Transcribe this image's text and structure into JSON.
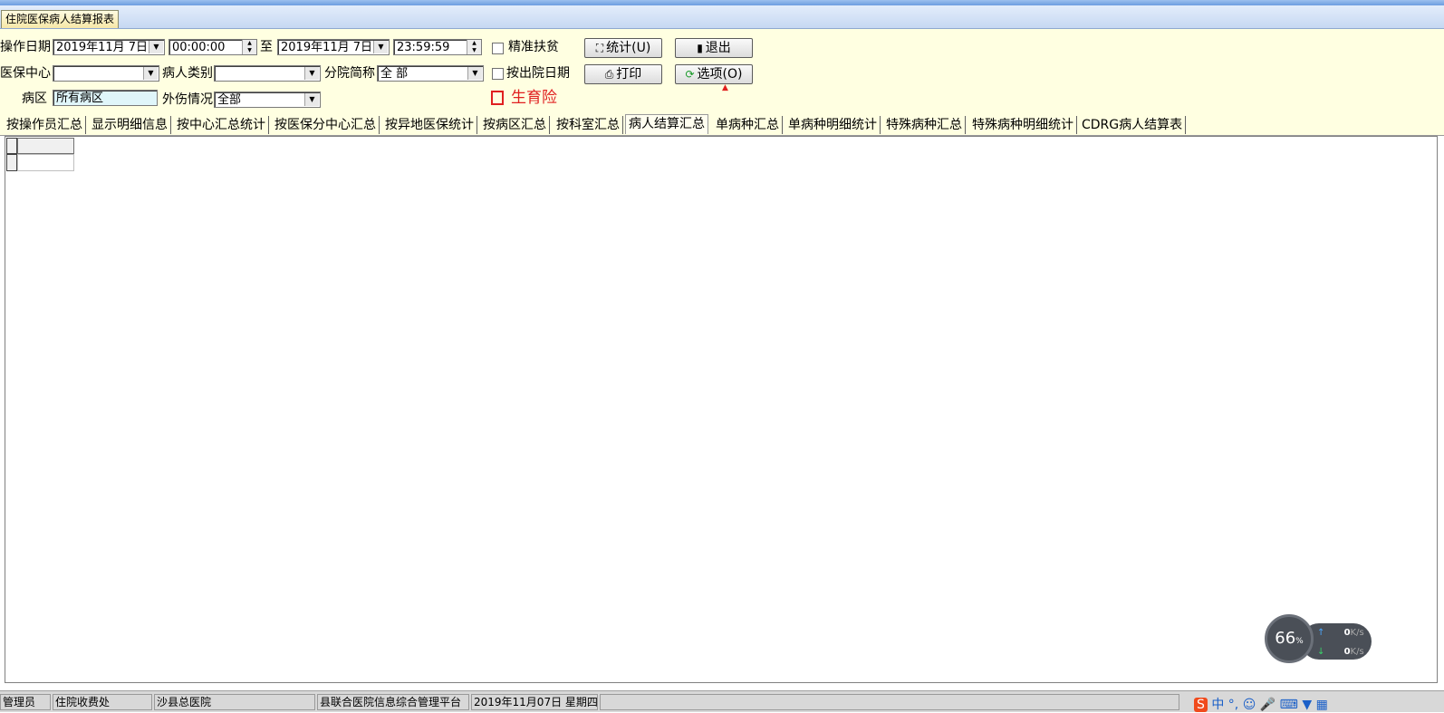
{
  "window": {
    "doc_tab": "住院医保病人结算报表"
  },
  "filters": {
    "op_date_label": "操作日期",
    "date_from": "2019年11月 7日",
    "time_from": "00:00:00",
    "to_label": "至",
    "date_to": "2019年11月 7日",
    "time_to": "23:59:59",
    "check_precise_poverty": "精准扶贫",
    "check_discharge_date": "按出院日期",
    "maternity_label": "生育险",
    "center_label": "医保中心",
    "center_value": "",
    "patient_type_label": "病人类别",
    "patient_type_value": "",
    "branch_label": "分院简称",
    "branch_value": "全 部",
    "ward_label": "病区",
    "ward_value": "所有病区",
    "injury_label": "外伤情况",
    "injury_value": "全部"
  },
  "buttons": {
    "stat": "统计(U)",
    "exit": "退出",
    "print": "打印",
    "options": "选项(O)"
  },
  "tabs": [
    "按操作员汇总",
    "显示明细信息",
    "按中心汇总统计",
    "按医保分中心汇总",
    "按异地医保统计",
    "按病区汇总",
    "按科室汇总",
    "病人结算汇总",
    "单病种汇总",
    "单病种明细统计",
    "特殊病种汇总",
    "特殊病种明细统计",
    "CDRG病人结算表"
  ],
  "active_tab": "病人结算汇总",
  "speed_widget": {
    "percent": "66",
    "unit": "%",
    "up": "0",
    "down": "0",
    "rate_unit": "K/s"
  },
  "statusbar": [
    "管理员",
    "住院收费处",
    "沙县总医院",
    "县联合医院信息综合管理平台",
    "2019年11月07日 星期四"
  ],
  "colors": {
    "panel_bg": "#ffffe1",
    "maternity_red": "#e02020",
    "titlebar": "#c6d8f2"
  }
}
